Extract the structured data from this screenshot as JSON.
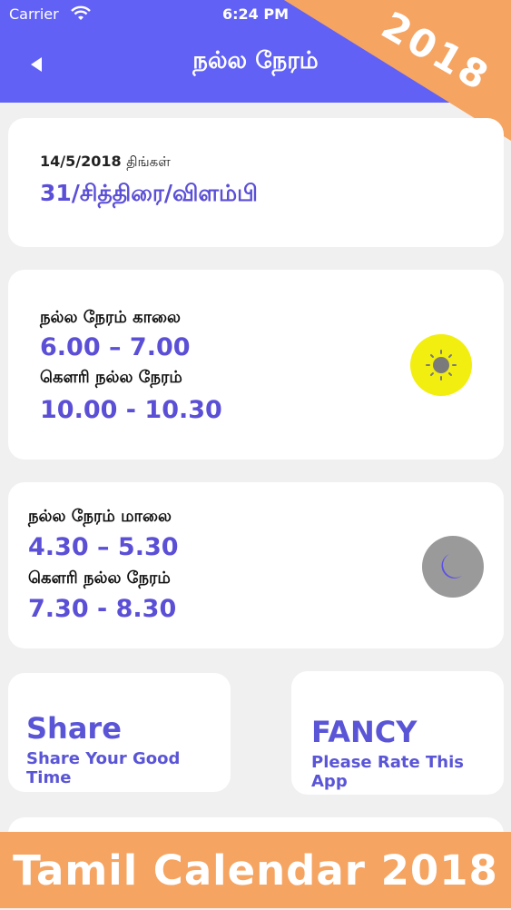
{
  "status_bar": {
    "carrier": "Carrier",
    "time": "6:24 PM"
  },
  "header": {
    "title": "நல்ல நேரம்"
  },
  "ribbon": {
    "text": "2018"
  },
  "date_card": {
    "date": "14/5/2018",
    "day": "திங்கள்",
    "tamil_date": "31/சித்திரை/விளம்பி"
  },
  "morning": {
    "label": "நல்ல நேரம் காலை",
    "time": "6.00 – 7.00",
    "gowri_label": "கௌரி நல்ல நேரம்",
    "gowri_time": "10.00 - 10.30"
  },
  "evening": {
    "label": "நல்ல நேரம் மாலை",
    "time": "4.30 – 5.30",
    "gowri_label": "கௌரி நல்ல நேரம்",
    "gowri_time": "7.30 - 8.30"
  },
  "share": {
    "title": "Share",
    "subtitle": "Share Your Good Time"
  },
  "fancy": {
    "title": "FANCY",
    "subtitle": "Please Rate This App"
  },
  "banner": {
    "text": "Tamil Calendar 2018"
  },
  "colors": {
    "header": "#6161f5",
    "accent": "#5b4fd6",
    "orange": "#f5a462",
    "sun": "#f2ee10",
    "moon_bg": "#9a9a9a"
  }
}
